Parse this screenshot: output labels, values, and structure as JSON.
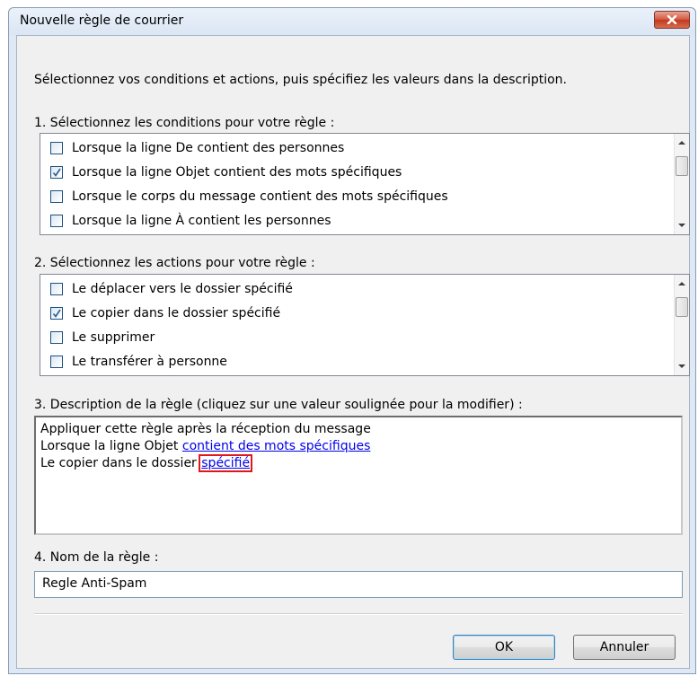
{
  "window": {
    "title": "Nouvelle règle de courrier"
  },
  "intro": "Sélectionnez vos conditions et actions, puis spécifiez les valeurs dans la description.",
  "conditions": {
    "label": "1. Sélectionnez les conditions pour votre règle :",
    "items": [
      {
        "label": "Lorsque la ligne De contient des personnes",
        "checked": false
      },
      {
        "label": "Lorsque la ligne Objet contient des mots spécifiques",
        "checked": true
      },
      {
        "label": "Lorsque le corps du message contient des mots spécifiques",
        "checked": false
      },
      {
        "label": "Lorsque la ligne À contient les personnes",
        "checked": false
      }
    ]
  },
  "actions": {
    "label": "2. Sélectionnez les actions pour votre règle :",
    "items": [
      {
        "label": "Le déplacer vers le dossier spécifié",
        "checked": false
      },
      {
        "label": "Le copier dans le dossier spécifié",
        "checked": true
      },
      {
        "label": "Le supprimer",
        "checked": false
      },
      {
        "label": "Le transférer à personne",
        "checked": false
      }
    ]
  },
  "description": {
    "label": "3. Description de la règle (cliquez sur une valeur soulignée pour la modifier) :",
    "line1": "Appliquer cette règle après la réception du message",
    "line2_prefix": "Lorsque la ligne Objet ",
    "line2_link": "contient des mots spécifiques",
    "line3_prefix": "Le copier dans le dossier ",
    "line3_link": "spécifié"
  },
  "rule_name": {
    "label": "4. Nom de la règle :",
    "value": "Regle Anti-Spam"
  },
  "buttons": {
    "ok": "OK",
    "cancel": "Annuler"
  },
  "colors": {
    "highlight": "#e0181d",
    "link": "#0000ee",
    "accent": "#3c7fb1"
  }
}
